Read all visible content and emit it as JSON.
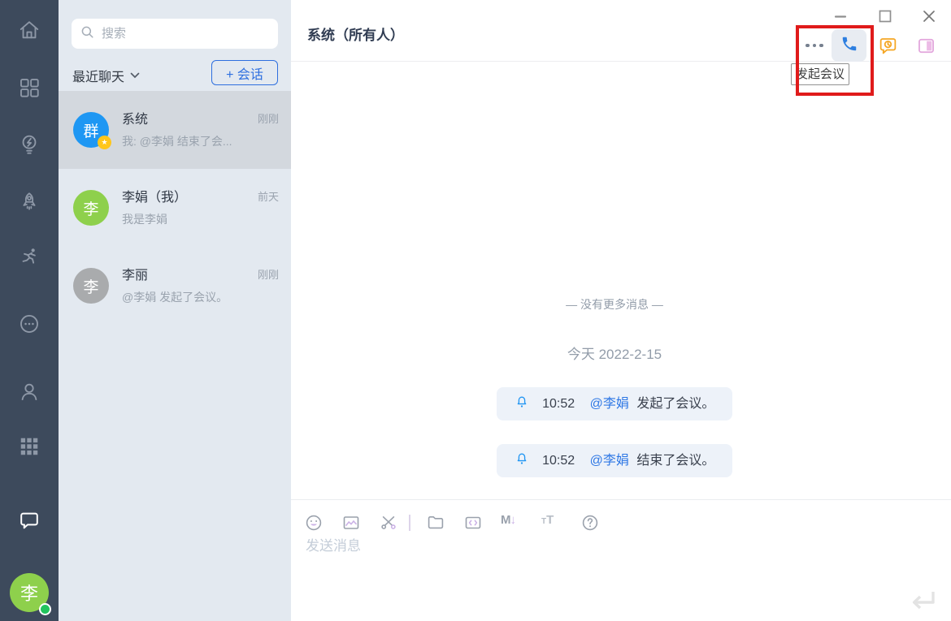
{
  "colors": {
    "rail_bg": "#3d4a5c",
    "list_bg": "#e3e9f0",
    "selected_item_bg": "#d3d8de",
    "accent_blue": "#2e6fdf",
    "mention_blue": "#2d77e5",
    "bubble_bg": "#edf2f9",
    "avatar_blue": "#1e97f3",
    "avatar_green": "#8ed04c",
    "avatar_gray": "#a9abad",
    "badge_yellow": "#ffc61a",
    "call_blue": "#2e7fe0",
    "history_orange": "#f5a623",
    "panel_pink": "#e2a5dc",
    "annotation_red": "#e01b1b",
    "online_green": "#21c45d"
  },
  "rail": {
    "avatar_text": "李",
    "icons": [
      "home-icon",
      "apps-icon",
      "idea-icon",
      "rocket-icon",
      "activity-icon",
      "more-circle-icon",
      "contacts-icon",
      "workbench-icon",
      "chat-icon"
    ]
  },
  "chat_list": {
    "search_placeholder": "搜索",
    "filter_label": "最近聊天",
    "new_chat_label": "+ 会话",
    "items": [
      {
        "avatar_text": "群",
        "badge": "★",
        "name": "系统",
        "time": "刚刚",
        "preview": "我: @李娟 结束了会...",
        "selected": true
      },
      {
        "avatar_text": "李",
        "name": "李娟（我）",
        "time": "前天",
        "preview": "我是李娟",
        "selected": false
      },
      {
        "avatar_text": "李",
        "name": "李丽",
        "time": "刚刚",
        "preview": "@李娟 发起了会议。",
        "selected": false
      }
    ]
  },
  "header": {
    "title": "系统（所有人）",
    "tooltip": "发起会议",
    "action_icons": [
      "more-icon",
      "call-icon",
      "chat-history-icon",
      "panel-icon"
    ],
    "window_icons": [
      "minimize-icon",
      "maximize-icon",
      "close-icon"
    ]
  },
  "messages": {
    "no_more": "— 没有更多消息 —",
    "date": "今天 2022-2-15",
    "items": [
      {
        "time": "10:52",
        "mention": "@李娟",
        "text": "发起了会议。"
      },
      {
        "time": "10:52",
        "mention": "@李娟",
        "text": "结束了会议。"
      }
    ]
  },
  "composer": {
    "placeholder": "发送消息",
    "toolbar_icons": [
      "emoji-icon",
      "image-icon",
      "scissors-icon",
      "folder-icon",
      "code-icon",
      "markdown-icon",
      "font-size-icon",
      "help-icon"
    ],
    "send_icon": "enter-icon"
  }
}
